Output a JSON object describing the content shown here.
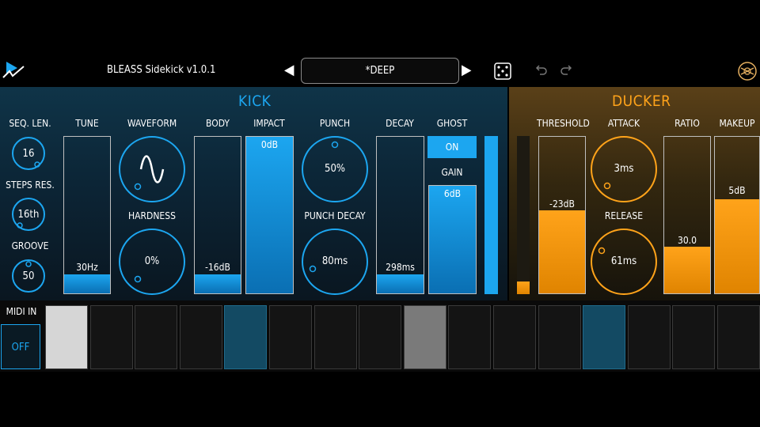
{
  "header": {
    "app_title": "BLEASS Sidekick  v1.0.1",
    "preset_name": "*DEEP",
    "prev_preset_icon": "triangle-left-icon",
    "next_preset_icon": "triangle-right-icon",
    "randomize_icon": "dice-icon",
    "undo_icon": "undo-icon",
    "redo_icon": "redo-icon",
    "menu_icon": "bleass-logo-icon"
  },
  "kick": {
    "title": "KICK",
    "seq_len": {
      "label": "SEQ. LEN.",
      "value": "16"
    },
    "steps_res": {
      "label": "STEPS RES.",
      "value": "16th"
    },
    "groove": {
      "label": "GROOVE",
      "value": "50"
    },
    "tune": {
      "label": "TUNE",
      "value": "30Hz",
      "level": 0.12
    },
    "waveform": {
      "label": "WAVEFORM"
    },
    "hardness": {
      "label": "HARDNESS",
      "value": "0%"
    },
    "body": {
      "label": "BODY",
      "value": "-16dB",
      "level": 0.12
    },
    "impact": {
      "label": "IMPACT",
      "value": "0dB",
      "level": 1.0
    },
    "punch": {
      "label": "PUNCH",
      "value": "50%"
    },
    "punch_decay": {
      "label": "PUNCH DECAY",
      "value": "80ms"
    },
    "decay": {
      "label": "DECAY",
      "value": "298ms",
      "level": 0.12
    },
    "ghost": {
      "label": "GHOST",
      "toggle": "ON"
    },
    "gain": {
      "label": "GAIN",
      "value": "6dB",
      "level": 1.0
    },
    "output_level": 1.0
  },
  "ducker": {
    "title": "DUCKER",
    "threshold": {
      "label": "THRESHOLD",
      "value": "-23dB",
      "level": 0.53
    },
    "attack": {
      "label": "ATTACK",
      "value": "3ms"
    },
    "release": {
      "label": "RELEASE",
      "value": "61ms"
    },
    "ratio": {
      "label": "RATIO",
      "value": "30.0",
      "level": 0.3
    },
    "makeup": {
      "label": "MAKEUP",
      "value": "5dB",
      "level": 0.6
    },
    "meter_level": 0.08
  },
  "midi": {
    "label": "MIDI IN",
    "state": "OFF"
  },
  "steps": [
    {
      "state": "light"
    },
    {
      "state": "off"
    },
    {
      "state": "off"
    },
    {
      "state": "off"
    },
    {
      "state": "blue"
    },
    {
      "state": "off"
    },
    {
      "state": "off"
    },
    {
      "state": "off"
    },
    {
      "state": "gray"
    },
    {
      "state": "off"
    },
    {
      "state": "off"
    },
    {
      "state": "off"
    },
    {
      "state": "blue"
    },
    {
      "state": "off"
    },
    {
      "state": "off"
    },
    {
      "state": "off"
    }
  ],
  "colors": {
    "kick_accent": "#1ca6f0",
    "ducker_accent": "#ffa31a"
  }
}
